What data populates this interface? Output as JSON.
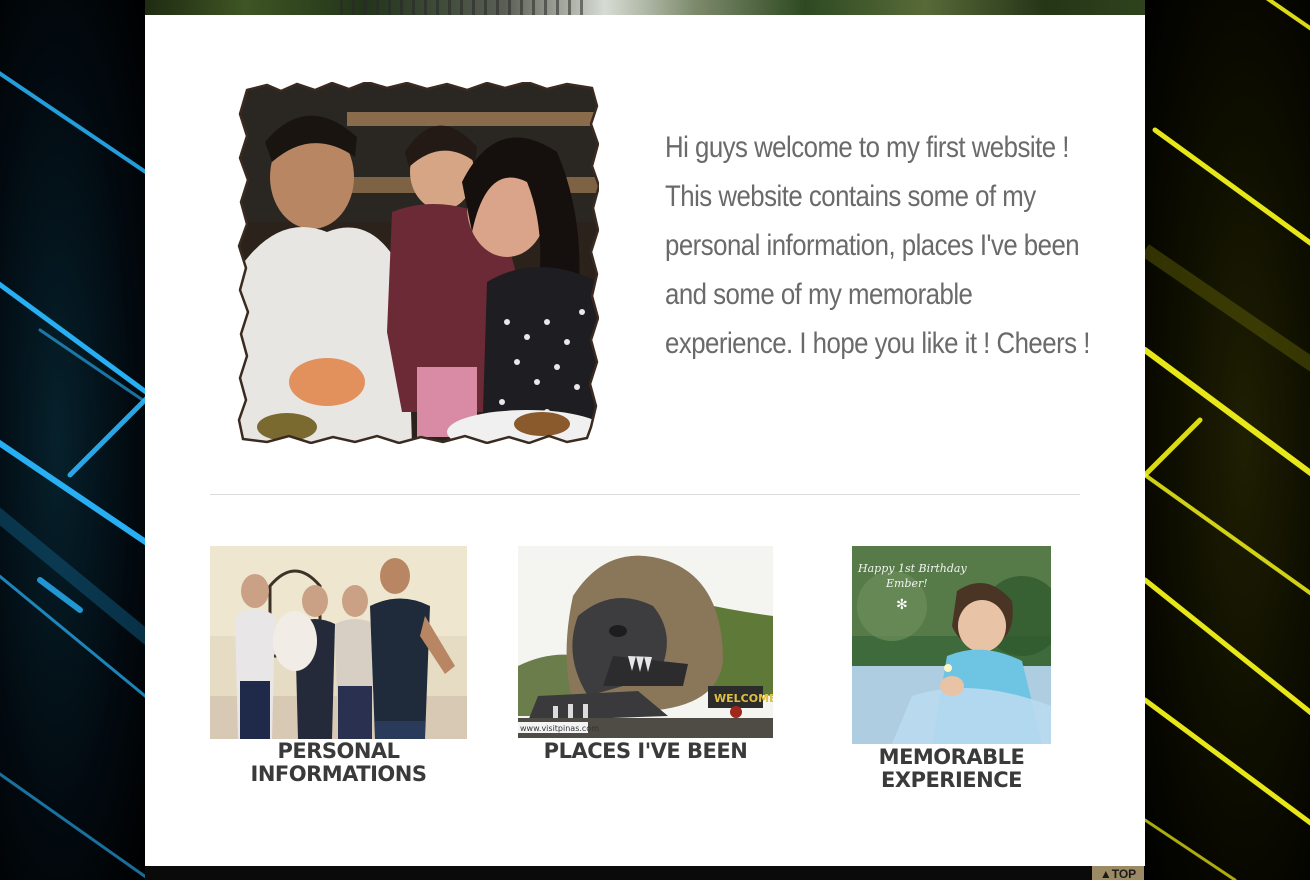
{
  "welcome": {
    "text": "Hi guys welcome to my first website ! This website contains some of my personal information, places I've been and some of my memorable experience. I hope you like it ! Cheers !"
  },
  "cards": [
    {
      "label_line1": "PERSONAL",
      "label_line2": "INFORMATIONS"
    },
    {
      "label_line1": "PLACES I'VE BEEN",
      "label_line2": "",
      "watermark": "www.visitpinas.com"
    },
    {
      "label_line1": "MEMORABLE",
      "label_line2": "EXPERIENCE",
      "caption_line1": "Happy 1st Birthday",
      "caption_line2": "Ember!"
    }
  ],
  "top_link": {
    "label": "▲TOP"
  },
  "colors": {
    "text_gray": "#6a6a6a",
    "panel": "#ffffff",
    "neon_blue": "#2ab7ff",
    "neon_yellow": "#f2f21a"
  }
}
